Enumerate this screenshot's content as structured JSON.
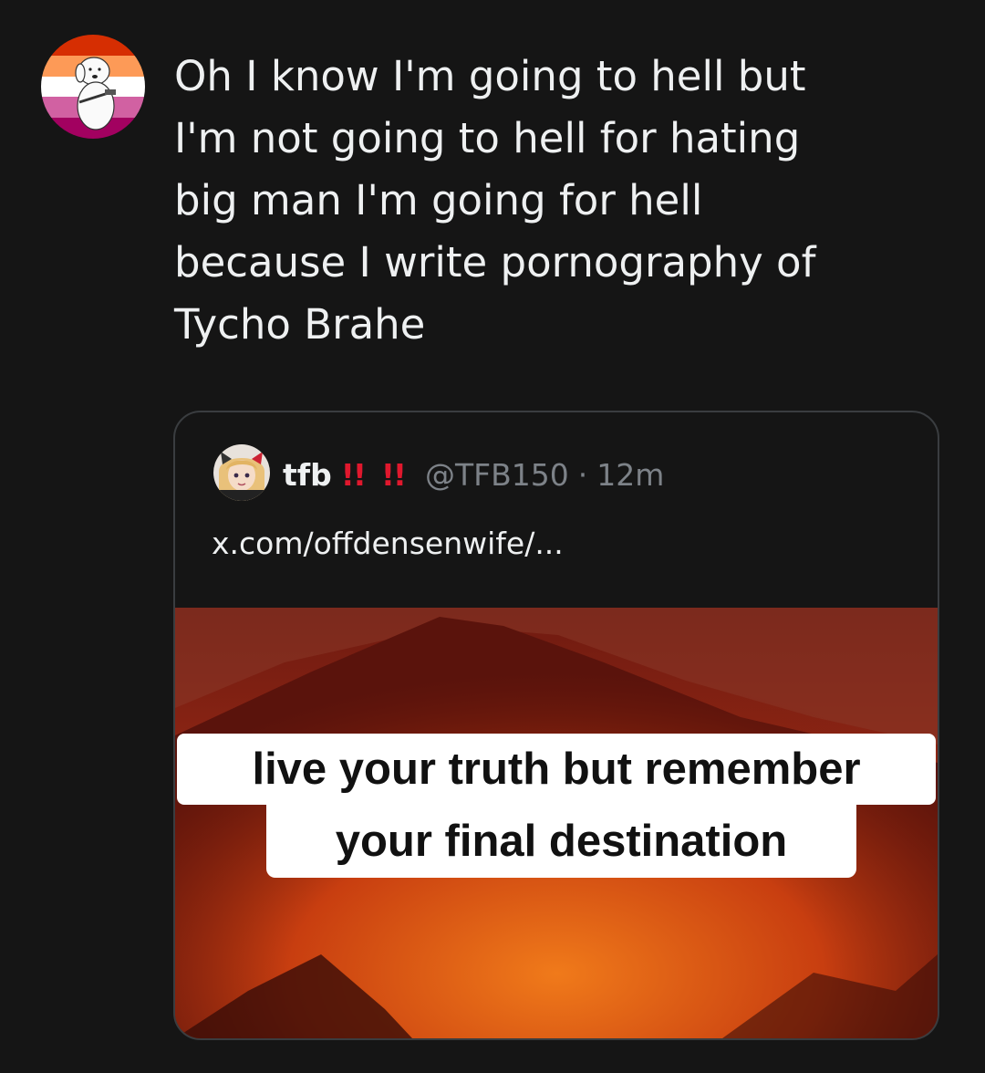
{
  "tweet": {
    "text_lines": [
      "Oh I know I'm going to hell but",
      "I'm not going to hell for hating",
      "big man I'm going for hell",
      "because I write pornography of",
      "Tycho Brahe"
    ]
  },
  "quote": {
    "name": "tfb",
    "badges": [
      "!!",
      "!!"
    ],
    "handle": "@TFB150",
    "separator": "·",
    "time": "12m",
    "link": "x.com/offdensenwife/...",
    "media_caption": {
      "line1": "live your truth but remember",
      "line2": "your final destination"
    }
  },
  "colors": {
    "background": "#151515",
    "text": "#eef0f1",
    "muted": "#7d8288",
    "badge": "#e0182d",
    "card_border": "#3a3d40"
  },
  "icons": {
    "author_avatar": "lesbian-flag-dog-avatar",
    "quote_avatar": "anime-girl-avatar"
  }
}
